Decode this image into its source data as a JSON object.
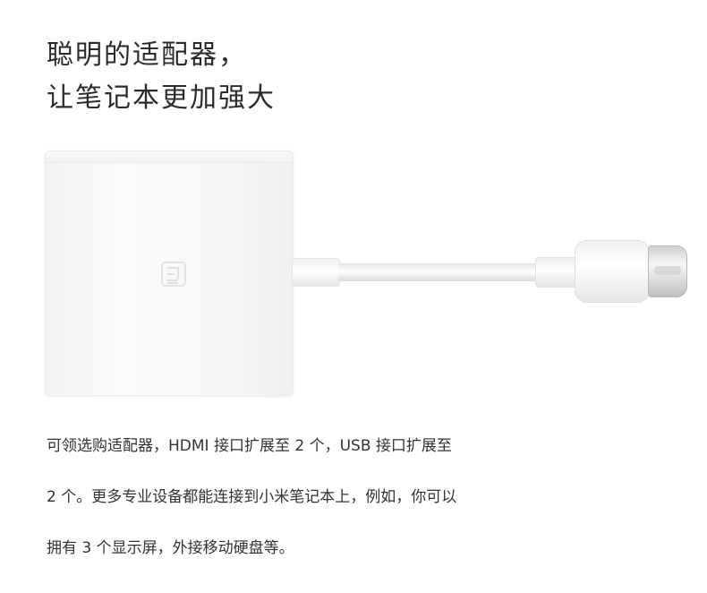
{
  "headline": {
    "line1": "聪明的适配器，",
    "line2": "让笔记本更加强大"
  },
  "product": {
    "logo_text": "mi",
    "icon": "usb-c-multiport-adapter"
  },
  "description": {
    "line1": "可领选购适配器，HDMI 接口扩展至 2 个，USB 接口扩展至",
    "line2": "2 个。更多专业设备都能连接到小米笔记本上，例如，你可以",
    "line3": "拥有 3 个显示屏，外接移动硬盘等。"
  },
  "colors": {
    "background": "#ffffff",
    "text": "#333333",
    "adapter": "#f6f6f6"
  }
}
